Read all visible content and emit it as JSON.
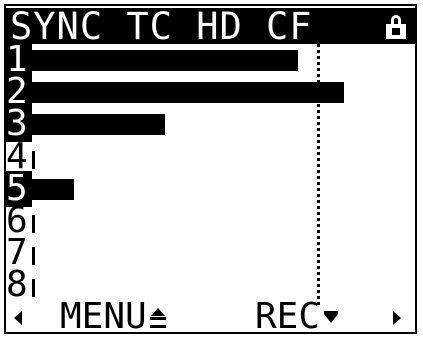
{
  "status_bar": {
    "text": "SYNC TC HD CF",
    "lock_icon": "lock-icon"
  },
  "channels": [
    {
      "label": "1",
      "armed": true,
      "level": 0.7
    },
    {
      "label": "2",
      "armed": true,
      "level": 0.82
    },
    {
      "label": "3",
      "armed": true,
      "level": 0.35
    },
    {
      "label": "4",
      "armed": false,
      "level": 0.0
    },
    {
      "label": "5",
      "armed": true,
      "level": 0.11
    },
    {
      "label": "6",
      "armed": false,
      "level": 0.0
    },
    {
      "label": "7",
      "armed": false,
      "level": 0.0
    },
    {
      "label": "8",
      "armed": false,
      "level": 0.0
    }
  ],
  "peak_marker_level": 0.74,
  "softkeys": {
    "left_arrow": "left-arrow-icon",
    "menu_label": "MENU",
    "menu_icon": "up-down-icon",
    "rec_label": "REC",
    "rec_icon": "down-arrow-icon",
    "right_arrow": "right-arrow-icon"
  },
  "colors": {
    "foreground": "#000000",
    "background": "#ffffff"
  }
}
